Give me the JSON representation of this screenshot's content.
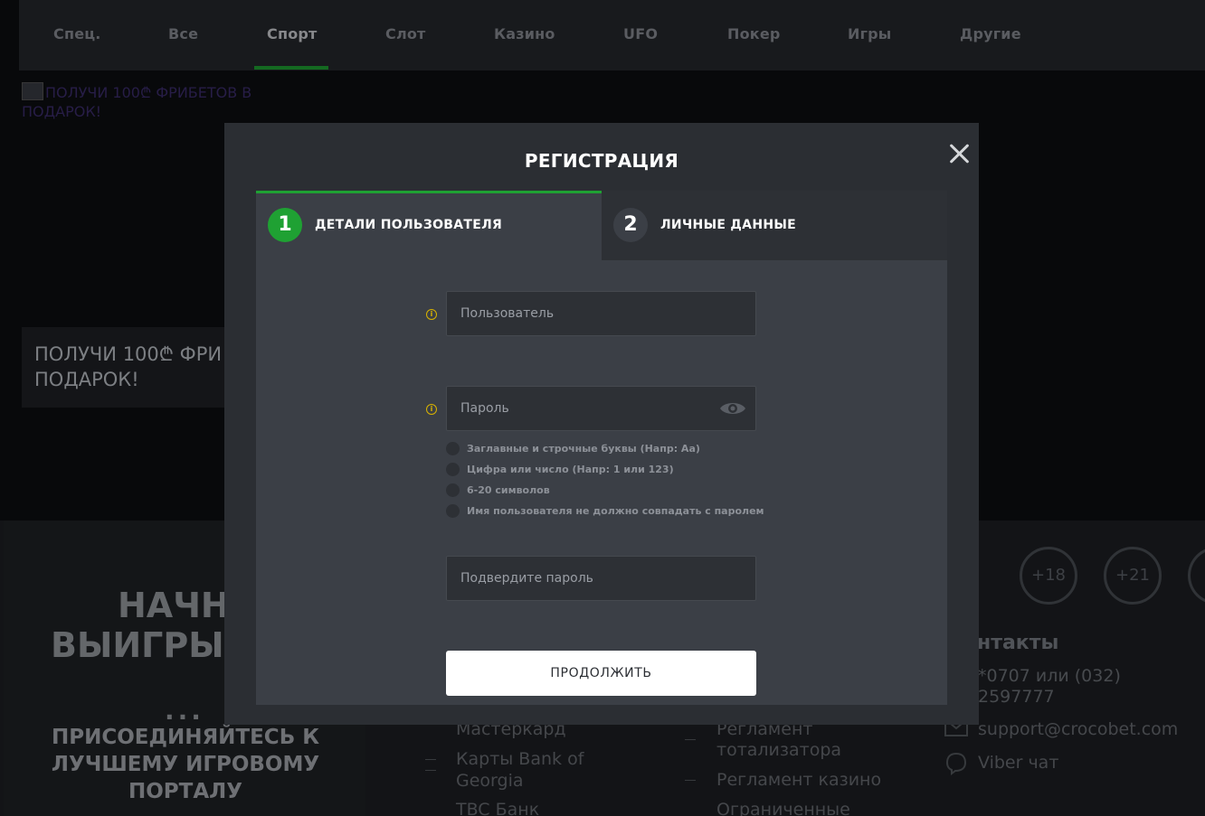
{
  "nav": {
    "tabs": [
      {
        "label": "Спец."
      },
      {
        "label": "Все"
      },
      {
        "label": "Спорт"
      },
      {
        "label": "Слот"
      },
      {
        "label": "Казино"
      },
      {
        "label": "UFO"
      },
      {
        "label": "Покер"
      },
      {
        "label": "Игры"
      },
      {
        "label": "Другие"
      }
    ],
    "active_tab": "Спорт"
  },
  "banner": {
    "broken_image_alt": "ПОЛУЧИ 100₾ ФРИБЕТОВ В ПОДАРОК!",
    "promo_line1": "ПОЛУЧИ 100₾ ФРИ",
    "promo_line2": "ПОДАРОК!"
  },
  "footer": {
    "title_line1": "НАЧН",
    "title_line2": "ВЫИГРЫ",
    "dots": "...",
    "join_text": "ПРИСОЕДИНЯЙТЕСЬ К ЛУЧШЕМУ ИГРОВОМУ ПОРТАЛУ",
    "payments": [
      "Мастеркард",
      "Карты Bank of",
      "Georgia",
      "TBC Банк"
    ],
    "rules": [
      "Регламент",
      "тотализатора",
      "Регламент казино",
      "Ограниченные"
    ],
    "age_badges": [
      "+18",
      "+21"
    ],
    "contacts_title": "нтакты",
    "phone_line1": "*0707 или (032)",
    "phone_line2": "2597777",
    "email": "support@crocobet.com",
    "viber": "Viber чат"
  },
  "modal": {
    "title": "РЕГИСТРАЦИЯ",
    "steps": [
      {
        "number": "1",
        "label": "ДЕТАЛИ ПОЛЬЗОВАТЕЛЯ",
        "active": true
      },
      {
        "number": "2",
        "label": "ЛИЧНЫЕ ДАННЫЕ",
        "active": false
      }
    ],
    "username_placeholder": "Пользователь",
    "password_placeholder": "Пароль",
    "confirm_placeholder": "Подвердите пароль",
    "password_rules": [
      "Заглавные и строчные буквы (Напр: Аа)",
      "Цифра или число (Напр: 1 или 123)",
      "6-20 символов",
      "Имя пользователя не должно совпадать с паролем"
    ],
    "continue_label": "ПРОДОЛЖИТЬ",
    "colors": {
      "accent": "#1fa133",
      "warning": "#d9b300"
    }
  }
}
